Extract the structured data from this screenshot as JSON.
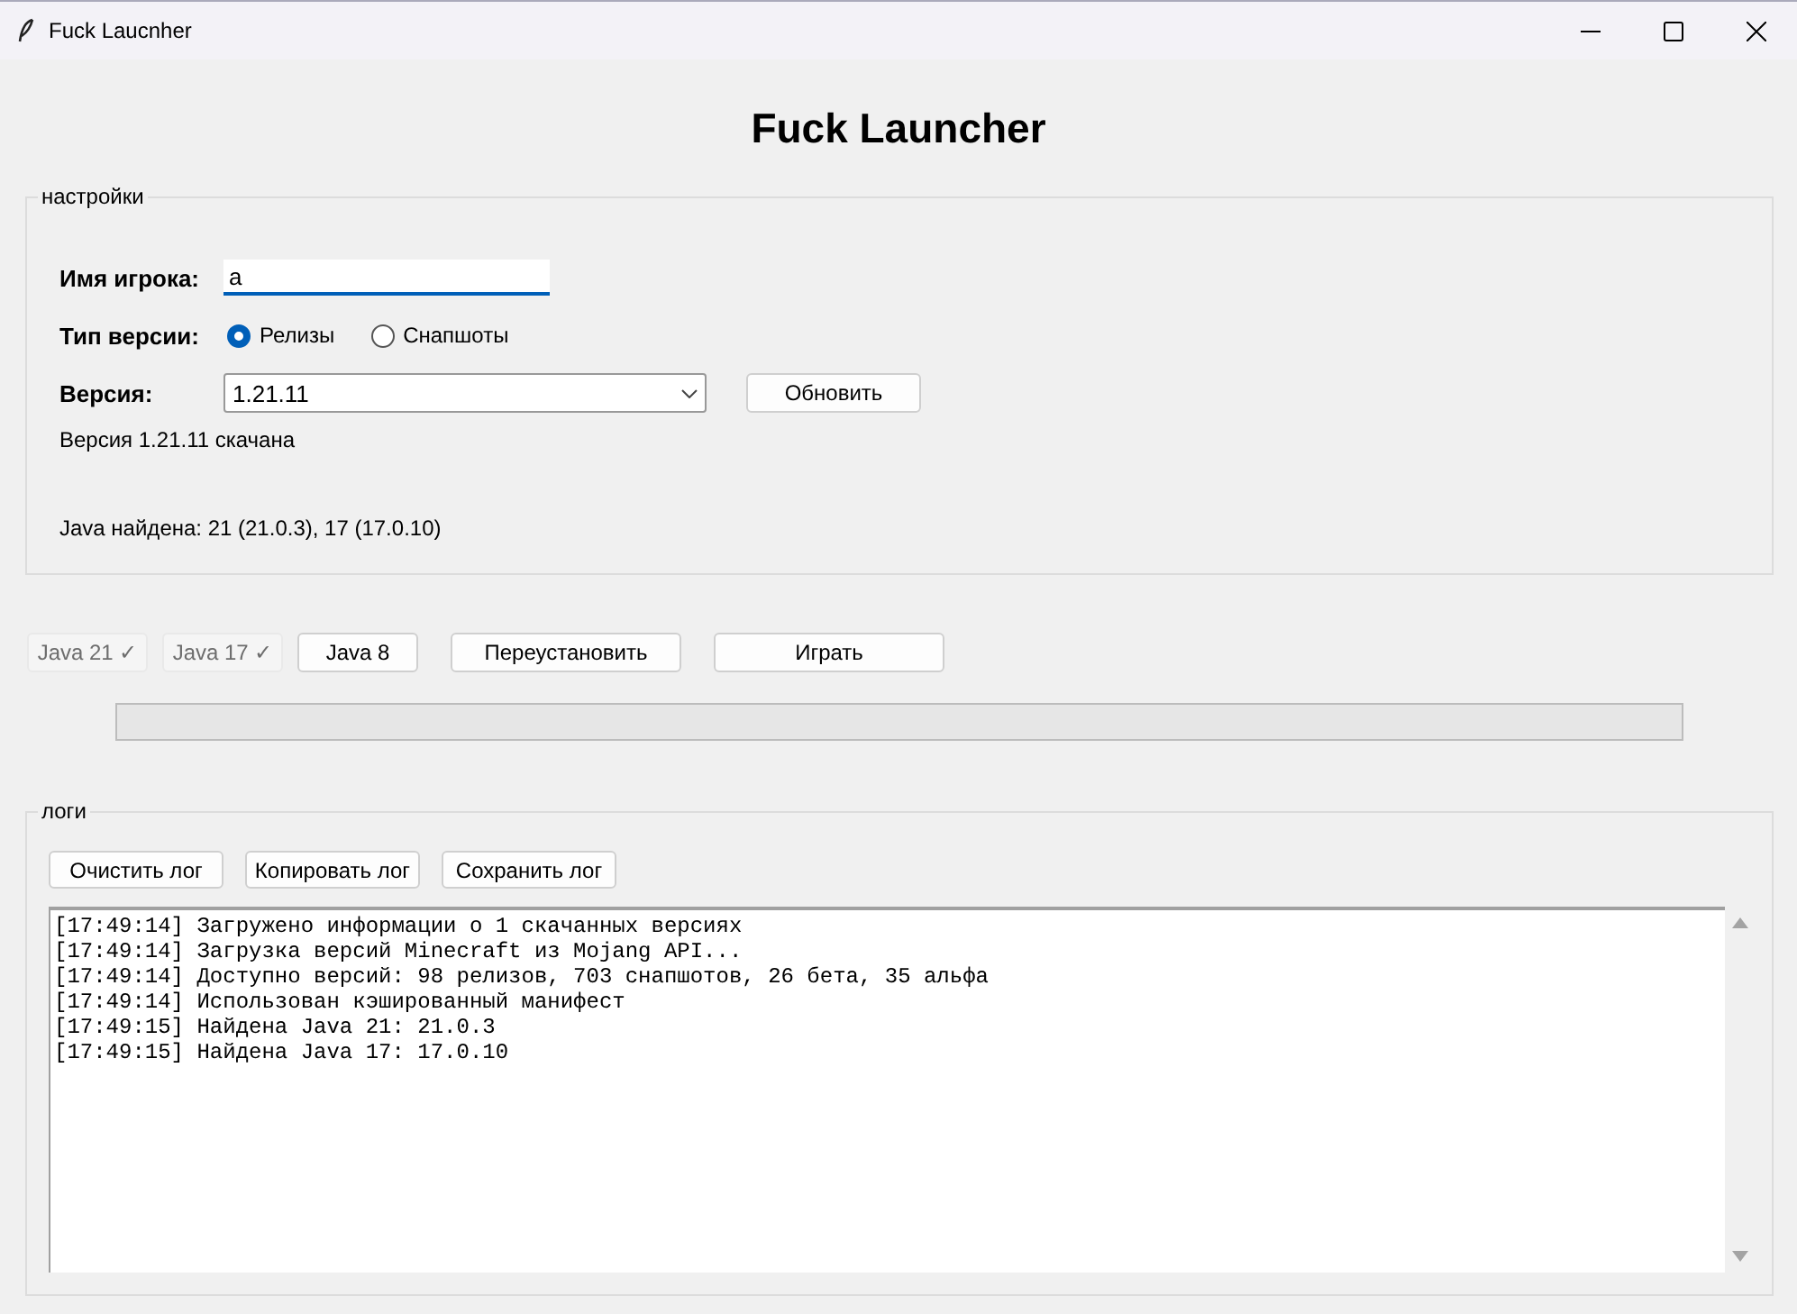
{
  "window": {
    "title": "Fuck Laucnher"
  },
  "heading": "Fuck Launcher",
  "settings": {
    "title": "настройки",
    "player_name": {
      "label": "Имя игрока:",
      "value": "a"
    },
    "version_type": {
      "label": "Тип версии:",
      "options": [
        {
          "label": "Релизы",
          "selected": true
        },
        {
          "label": "Снапшоты",
          "selected": false
        }
      ]
    },
    "version": {
      "label": "Версия:",
      "value": "1.21.11"
    },
    "refresh_button": "Обновить",
    "status": "Версия 1.21.11 скачана",
    "java_status": "Java найдена: 21 (21.0.3), 17 (17.0.10)"
  },
  "actions": [
    {
      "label": "Java 21 ✓",
      "disabled": true
    },
    {
      "label": "Java 17 ✓",
      "disabled": true
    },
    {
      "label": "Java 8",
      "disabled": false
    },
    {
      "label": "Переустановить",
      "disabled": false
    },
    {
      "label": "Играть",
      "disabled": false
    }
  ],
  "progress": {
    "level": 0
  },
  "logs": {
    "title": "логи",
    "buttons": [
      "Очистить лог",
      "Копировать лог",
      "Сохранить лог"
    ],
    "lines": [
      "[17:49:14] Загружено информации о 1 скачанных версиях",
      "[17:49:14] Загрузка версий Minecraft из Mojang API...",
      "[17:49:14] Доступно версий: 98 релизов, 703 снапшотов, 26 бета, 35 альфа",
      "[17:49:14] Использован кэшированный манифест",
      "[17:49:15] Найдена Java 21: 21.0.3",
      "[17:49:15] Найдена Java 17: 17.0.10"
    ]
  }
}
